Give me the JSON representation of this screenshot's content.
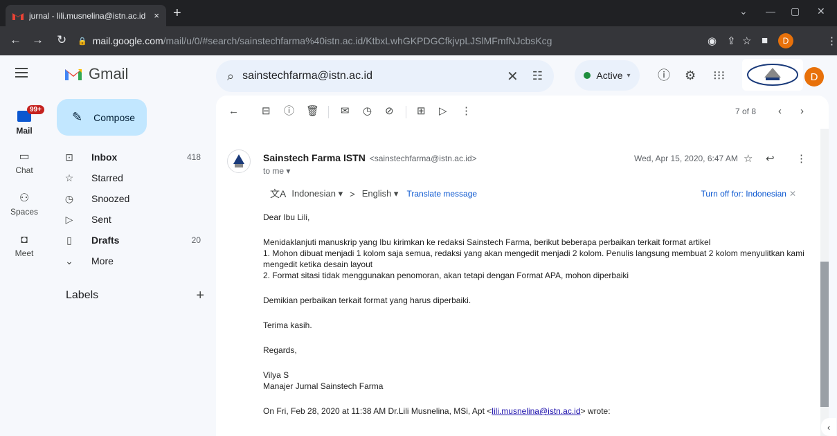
{
  "browser": {
    "tab_title": "jurnal - lili.musnelina@istn.ac.id",
    "tab_close": "×",
    "new_tab": "+",
    "url_host": "mail.google.com",
    "url_path": "/mail/u/0/#search/sainstechfarma%40istn.ac.id/KtbxLwhGKPDGCfkjvpLJSlMFmfNJcbsKcg",
    "profile_initial": "D"
  },
  "gmail": {
    "app_name": "Gmail",
    "search_value": "sainstechfarma@istn.ac.id",
    "status_label": "Active",
    "avatar_initial": "D"
  },
  "rail": {
    "mail_label": "Mail",
    "mail_badge": "99+",
    "chat_label": "Chat",
    "spaces_label": "Spaces",
    "meet_label": "Meet"
  },
  "nav": {
    "compose_label": "Compose",
    "items": [
      {
        "label": "Inbox",
        "count": "418"
      },
      {
        "label": "Starred",
        "count": ""
      },
      {
        "label": "Snoozed",
        "count": ""
      },
      {
        "label": "Sent",
        "count": ""
      },
      {
        "label": "Drafts",
        "count": "20"
      },
      {
        "label": "More",
        "count": ""
      }
    ],
    "labels_heading": "Labels"
  },
  "toolbar": {
    "pager": "7 of 8"
  },
  "message": {
    "sender_name": "Sainstech Farma ISTN",
    "sender_email": "<sainstechfarma@istn.ac.id>",
    "to": "to me ▾",
    "date": "Wed, Apr 15, 2020, 6:47 AM",
    "translate": {
      "from_lang": "Indonesian ▾",
      "arrow": ">",
      "to_lang": "English ▾",
      "action": "Translate message",
      "turn_off": "Turn off for: Indonesian"
    },
    "body": {
      "greeting": "Dear Ibu Lili,",
      "intro": "Menidaklanjuti manuskrip yang Ibu kirimkan ke redaksi Sainstech Farma, berikut beberapa perbaikan terkait format artikel",
      "point1": "1. Mohon dibuat menjadi 1 kolom saja semua, redaksi yang akan mengedit menjadi 2 kolom. Penulis langsung membuat 2 kolom menyulitkan kami mengedit ketika desain layout",
      "point2": "2. Format sitasi tidak menggunakan penomoran, akan tetapi dengan Format APA, mohon diperbaiki",
      "closing": "Demikian perbaikan terkait format yang harus diperbaiki.",
      "thanks": "Terima kasih.",
      "regards": "Regards,",
      "sign_name": "Vilya S",
      "sign_title": "Manajer Jurnal Sainstech Farma",
      "quote_prefix": "On Fri, Feb 28, 2020 at 11:38 AM Dr.Lili Musnelina, MSi, Apt <",
      "quote_email": "lili.musnelina@istn.ac.id",
      "quote_suffix": "> wrote:"
    }
  }
}
